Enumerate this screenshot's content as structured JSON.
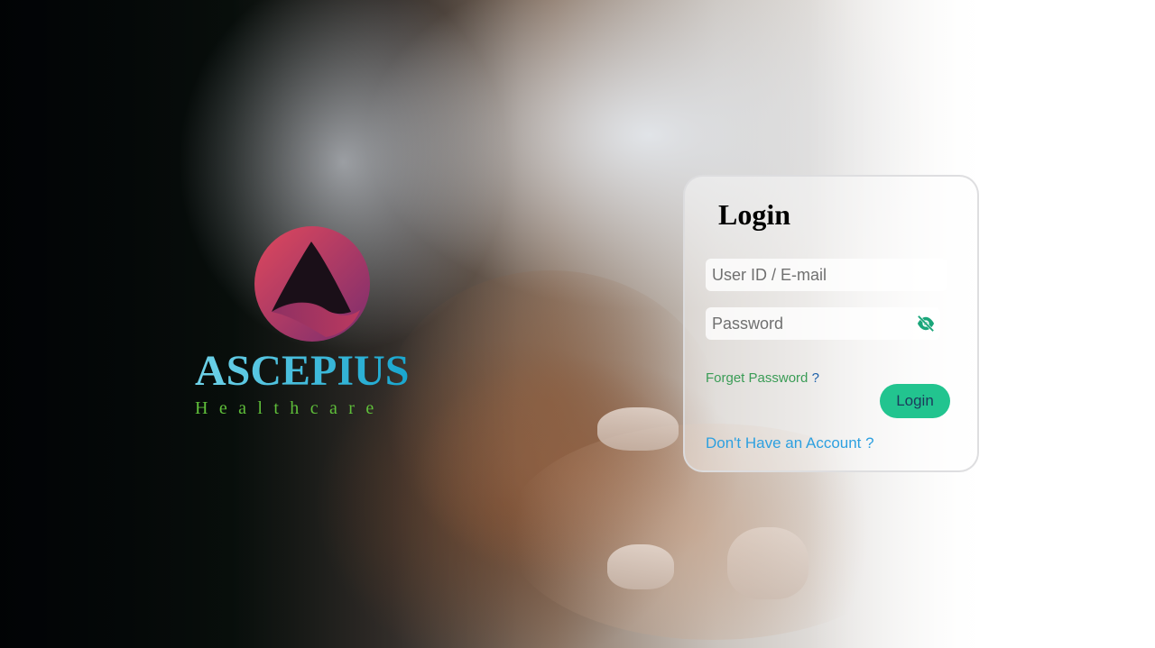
{
  "brand": {
    "name": "ASCEPIUS",
    "tagline": "Healthcare",
    "colors": {
      "logo_circle_start": "#e0485c",
      "logo_circle_end": "#7a2d6e",
      "name_gradient_start": "#6fd2e8",
      "name_gradient_end": "#19a6cf",
      "tagline": "#5fbf3a"
    }
  },
  "login": {
    "title": "Login",
    "user_placeholder": "User ID / E-mail",
    "password_placeholder": "Password",
    "password_toggle_icon": "eye-off-icon",
    "forgot_label": "Forget Password",
    "forgot_suffix": "?",
    "submit_label": "Login",
    "signup_label": "Don't Have an Account ?",
    "colors": {
      "submit_bg": "#22c48f",
      "forgot_text": "#3a9c56",
      "signup_text": "#2da0e0",
      "eye_icon": "#1aa67a"
    }
  }
}
